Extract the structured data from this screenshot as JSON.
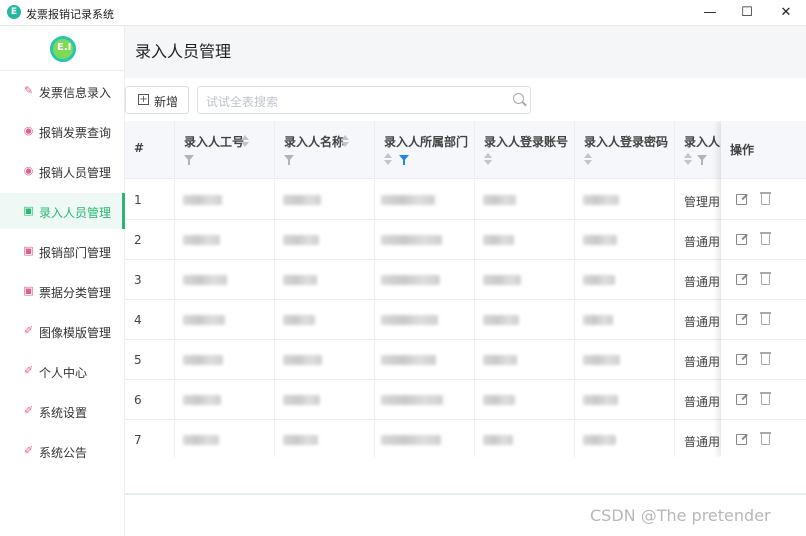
{
  "window": {
    "title": "发票报销记录系统",
    "icon_text": "E",
    "minimize_label": "—",
    "maximize_label": "☐",
    "close_label": "✕"
  },
  "sidebar": {
    "logo_text": "E.I",
    "items": [
      {
        "label": "发票信息录入",
        "icon": "invoice-icon",
        "glyph": "✎",
        "active": false
      },
      {
        "label": "报销发票查询",
        "icon": "search-invoice-icon",
        "glyph": "◉",
        "active": false
      },
      {
        "label": "报销人员管理",
        "icon": "people-icon",
        "glyph": "◉",
        "active": false
      },
      {
        "label": "录入人员管理",
        "icon": "entry-people-icon",
        "glyph": "▣",
        "active": true
      },
      {
        "label": "报销部门管理",
        "icon": "department-icon",
        "glyph": "▣",
        "active": false
      },
      {
        "label": "票据分类管理",
        "icon": "category-icon",
        "glyph": "▣",
        "active": false
      },
      {
        "label": "图像模版管理",
        "icon": "image-template-icon",
        "glyph": "✐",
        "active": false
      },
      {
        "label": "个人中心",
        "icon": "user-center-icon",
        "glyph": "✐",
        "active": false
      },
      {
        "label": "系统设置",
        "icon": "settings-icon",
        "glyph": "✐",
        "active": false
      },
      {
        "label": "系统公告",
        "icon": "announcement-icon",
        "glyph": "✐",
        "active": false
      }
    ]
  },
  "main": {
    "page_title": "录入人员管理",
    "add_button": "新增",
    "search_placeholder": "试试全表搜索"
  },
  "table": {
    "columns": [
      {
        "label": "#"
      },
      {
        "label": "录入人工号"
      },
      {
        "label": "录入人名称"
      },
      {
        "label": "录入人所属部门"
      },
      {
        "label": "录入人登录账号"
      },
      {
        "label": "录入人登录密码"
      },
      {
        "label": "录入人…"
      }
    ],
    "operations_label": "操作",
    "rows": [
      {
        "index": "1",
        "role": "管理用…"
      },
      {
        "index": "2",
        "role": "普通用…"
      },
      {
        "index": "3",
        "role": "普通用…"
      },
      {
        "index": "4",
        "role": "普通用…"
      },
      {
        "index": "5",
        "role": "普通用…"
      },
      {
        "index": "6",
        "role": "普通用…"
      },
      {
        "index": "7",
        "role": "普通用…"
      }
    ]
  },
  "watermark": "CSDN @The  pretender",
  "colors": {
    "accent": "#2bb673",
    "filter_active": "#1e88e5",
    "header_bg": "#f5f7fa"
  }
}
